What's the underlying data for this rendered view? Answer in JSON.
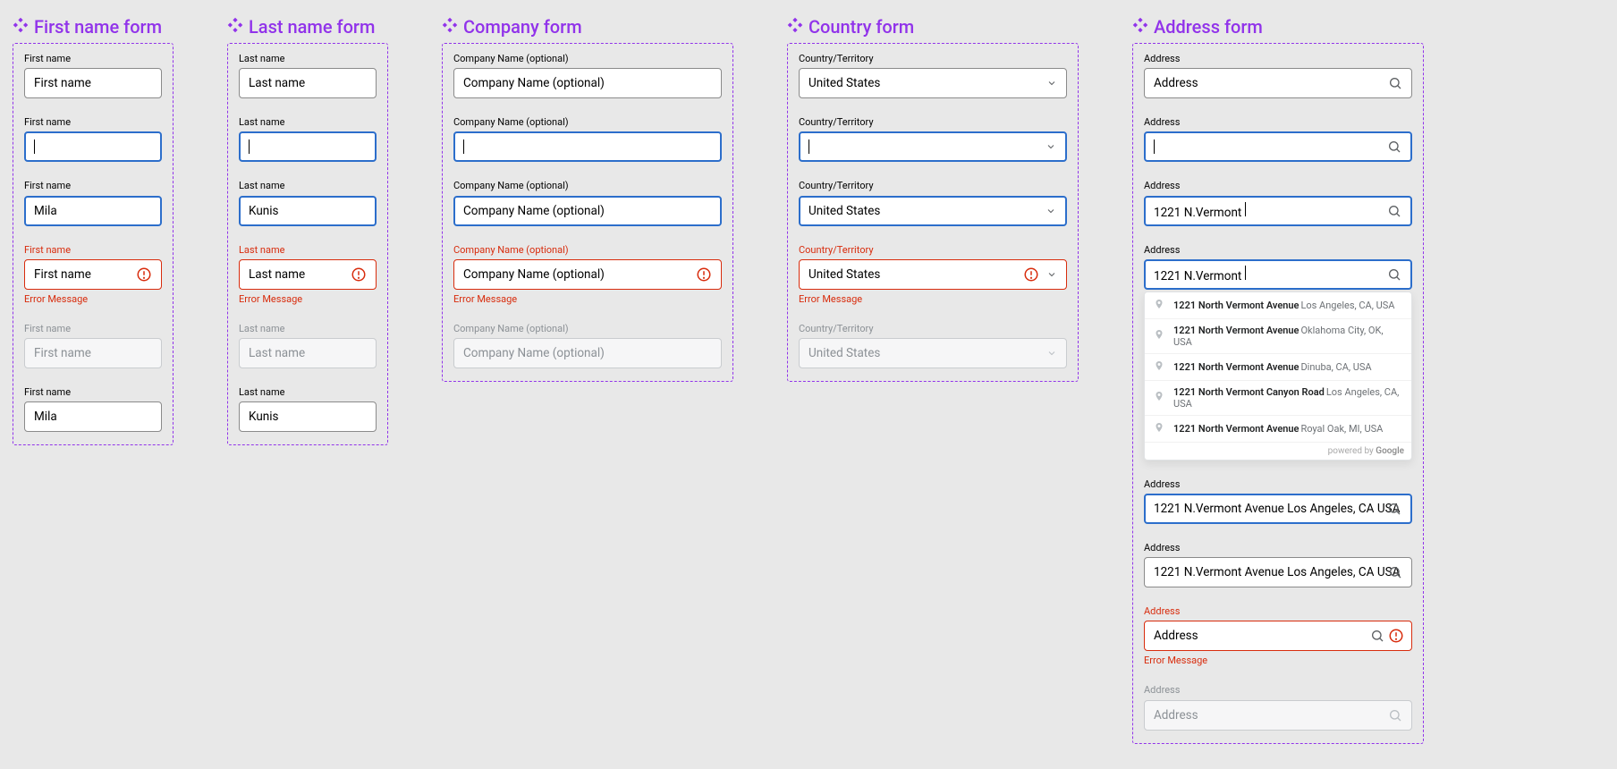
{
  "groups": {
    "first": {
      "title": "First name form"
    },
    "last": {
      "title": "Last name form"
    },
    "company": {
      "title": "Company form"
    },
    "country": {
      "title": "Country form"
    },
    "address": {
      "title": "Address form"
    }
  },
  "labels": {
    "first": "First name",
    "last": "Last name",
    "company": "Company Name (optional)",
    "country": "Country/Territory",
    "address": "Address"
  },
  "placeholders": {
    "first": "First name",
    "last": "Last name",
    "company": "Company Name (optional)",
    "country": "United States",
    "address": "Address"
  },
  "values": {
    "first_filled": "Mila",
    "last_filled": "Kunis",
    "country_value": "United States",
    "addr_partial": "1221 N.Vermont ",
    "addr_full": "1221 N.Vermont Avenue Los Angeles, CA USA"
  },
  "error_text": "Error Message",
  "autocomplete": {
    "items": [
      {
        "main": "1221 North Vermont Avenue",
        "rest": "Los Angeles, CA, USA"
      },
      {
        "main": "1221 North Vermont Avenue",
        "rest": "Oklahoma City, OK, USA"
      },
      {
        "main": "1221 North Vermont Avenue",
        "rest": "Dinuba, CA, USA"
      },
      {
        "main": "1221 North Vermont Canyon Road",
        "rest": "Los Angeles, CA, USA"
      },
      {
        "main": "1221 North Vermont Avenue",
        "rest": "Royal Oak, MI, USA"
      }
    ],
    "powered_by": "powered by",
    "provider": "Google"
  }
}
